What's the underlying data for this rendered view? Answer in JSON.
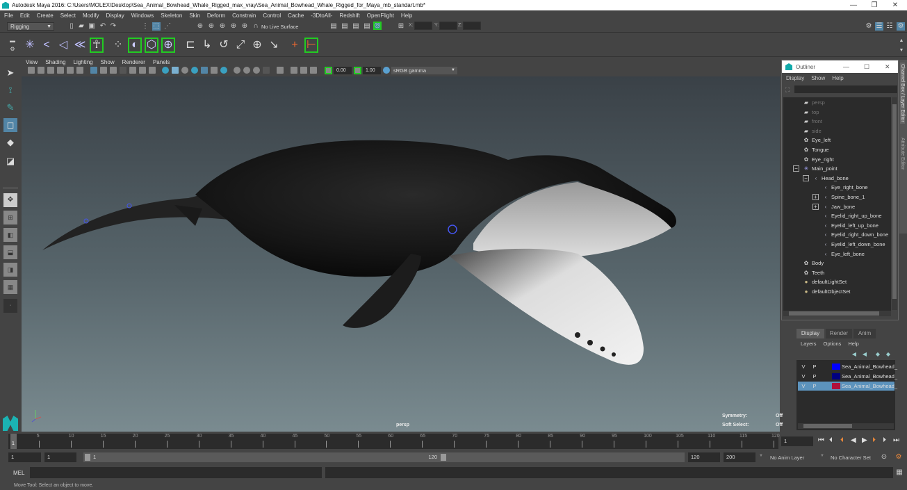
{
  "title_bar": {
    "title": "Autodesk Maya 2016: C:\\Users\\MOLEX\\Desktop\\Sea_Animal_Bowhead_Whale_Rigged_max_vray\\Sea_Animal_Bowhead_Whale_Rigged_for_Maya_mb_standart.mb*",
    "minimize": "—",
    "maximize": "❐",
    "close": "✕"
  },
  "menu_bar": [
    "File",
    "Edit",
    "Create",
    "Select",
    "Modify",
    "Display",
    "Windows",
    "Skeleton",
    "Skin",
    "Deform",
    "Constrain",
    "Control",
    "Cache",
    "-3DtoAll-",
    "Redshift",
    "OpenFlight",
    "Help"
  ],
  "status_line": {
    "mode": "Rigging",
    "live_surface": "No Live Surface",
    "x_label": "X:",
    "y_label": "Y:",
    "z_label": "Z:"
  },
  "shelf": {
    "icons": [
      "joint-tool",
      "ik-handle",
      "ik-spline",
      "insert-joint",
      "humanIK",
      "create-cluster",
      "create-lattice",
      "wrap",
      "soft-mod",
      "parent-constraint",
      "point-constraint",
      "orient-constraint",
      "scale-constraint",
      "aim-constraint",
      "pole-vector-constraint",
      "locator",
      "set-driven-key"
    ]
  },
  "toolbox": [
    "select-tool",
    "lasso-tool",
    "paint-select-tool",
    "move-tool",
    "rotate-tool",
    "scale-tool"
  ],
  "viewport": {
    "menus": [
      "View",
      "Shading",
      "Lighting",
      "Show",
      "Renderer",
      "Panels"
    ],
    "exposure": "0.00",
    "gamma": "1.00",
    "color_space": "sRGB gamma",
    "camera_label": "persp",
    "hud": {
      "symmetry_label": "Symmetry:",
      "symmetry_value": "Off",
      "soft_select_label": "Soft Select:",
      "soft_select_value": "Off"
    }
  },
  "outliner": {
    "title": "Outliner",
    "menus": [
      "Display",
      "Show",
      "Help"
    ],
    "items": [
      {
        "label": "persp",
        "icon": "camera",
        "dim": true
      },
      {
        "label": "top",
        "icon": "camera",
        "dim": true
      },
      {
        "label": "front",
        "icon": "camera",
        "dim": true
      },
      {
        "label": "side",
        "icon": "camera",
        "dim": true
      },
      {
        "label": "Eye_left",
        "icon": "mesh"
      },
      {
        "label": "Tongue",
        "icon": "mesh"
      },
      {
        "label": "Eye_right",
        "icon": "mesh"
      },
      {
        "label": "Main_point",
        "icon": "locator",
        "expand": "−"
      },
      {
        "label": "Head_bone",
        "icon": "joint",
        "expand": "−"
      },
      {
        "label": "Eye_right_bone",
        "icon": "joint"
      },
      {
        "label": "Spine_bone_1",
        "icon": "joint",
        "expand": "+"
      },
      {
        "label": "Jaw_bone",
        "icon": "joint",
        "expand": "+"
      },
      {
        "label": "Eyelid_right_up_bone",
        "icon": "joint"
      },
      {
        "label": "Eyelid_left_up_bone",
        "icon": "joint"
      },
      {
        "label": "Eyelid_right_down_bone",
        "icon": "joint"
      },
      {
        "label": "Eyelid_left_down_bone",
        "icon": "joint"
      },
      {
        "label": "Eye_left_bone",
        "icon": "joint"
      },
      {
        "label": "Body",
        "icon": "mesh"
      },
      {
        "label": "Teeth",
        "icon": "mesh"
      },
      {
        "label": "defaultLightSet",
        "icon": "set"
      },
      {
        "label": "defaultObjectSet",
        "icon": "set"
      }
    ]
  },
  "side_tabs": {
    "channel_box": "Channel Box / Layer Editor",
    "attribute_editor": "Attribute Editor"
  },
  "layer_editor": {
    "tabs": [
      "Display",
      "Render",
      "Anim"
    ],
    "menus": [
      "Layers",
      "Options",
      "Help"
    ],
    "layers": [
      {
        "v": "V",
        "p": "P",
        "color": "#0000ff",
        "name": "Sea_Animal_Bowhead_"
      },
      {
        "v": "V",
        "p": "P",
        "color": "#000080",
        "name": "Sea_Animal_Bowhead_"
      },
      {
        "v": "V",
        "p": "P",
        "color": "#b0103a",
        "name": "Sea_Animal_Bowhead_",
        "selected": true
      }
    ]
  },
  "timeline": {
    "ticks": [
      "5",
      "10",
      "15",
      "20",
      "25",
      "30",
      "35",
      "40",
      "45",
      "50",
      "55",
      "60",
      "65",
      "70",
      "75",
      "80",
      "85",
      "90",
      "95",
      "100",
      "105",
      "110",
      "115",
      "120"
    ],
    "current_frame_marker": "1",
    "current_frame": "1"
  },
  "range": {
    "start": "1",
    "playback_start": "1",
    "slider_start": "1",
    "slider_end": "120",
    "playback_end": "120",
    "end": "200",
    "anim_layer": "No Anim Layer",
    "character_set": "No Character Set"
  },
  "command_line": {
    "label": "MEL"
  },
  "help_line": "Move Tool: Select an object to move."
}
